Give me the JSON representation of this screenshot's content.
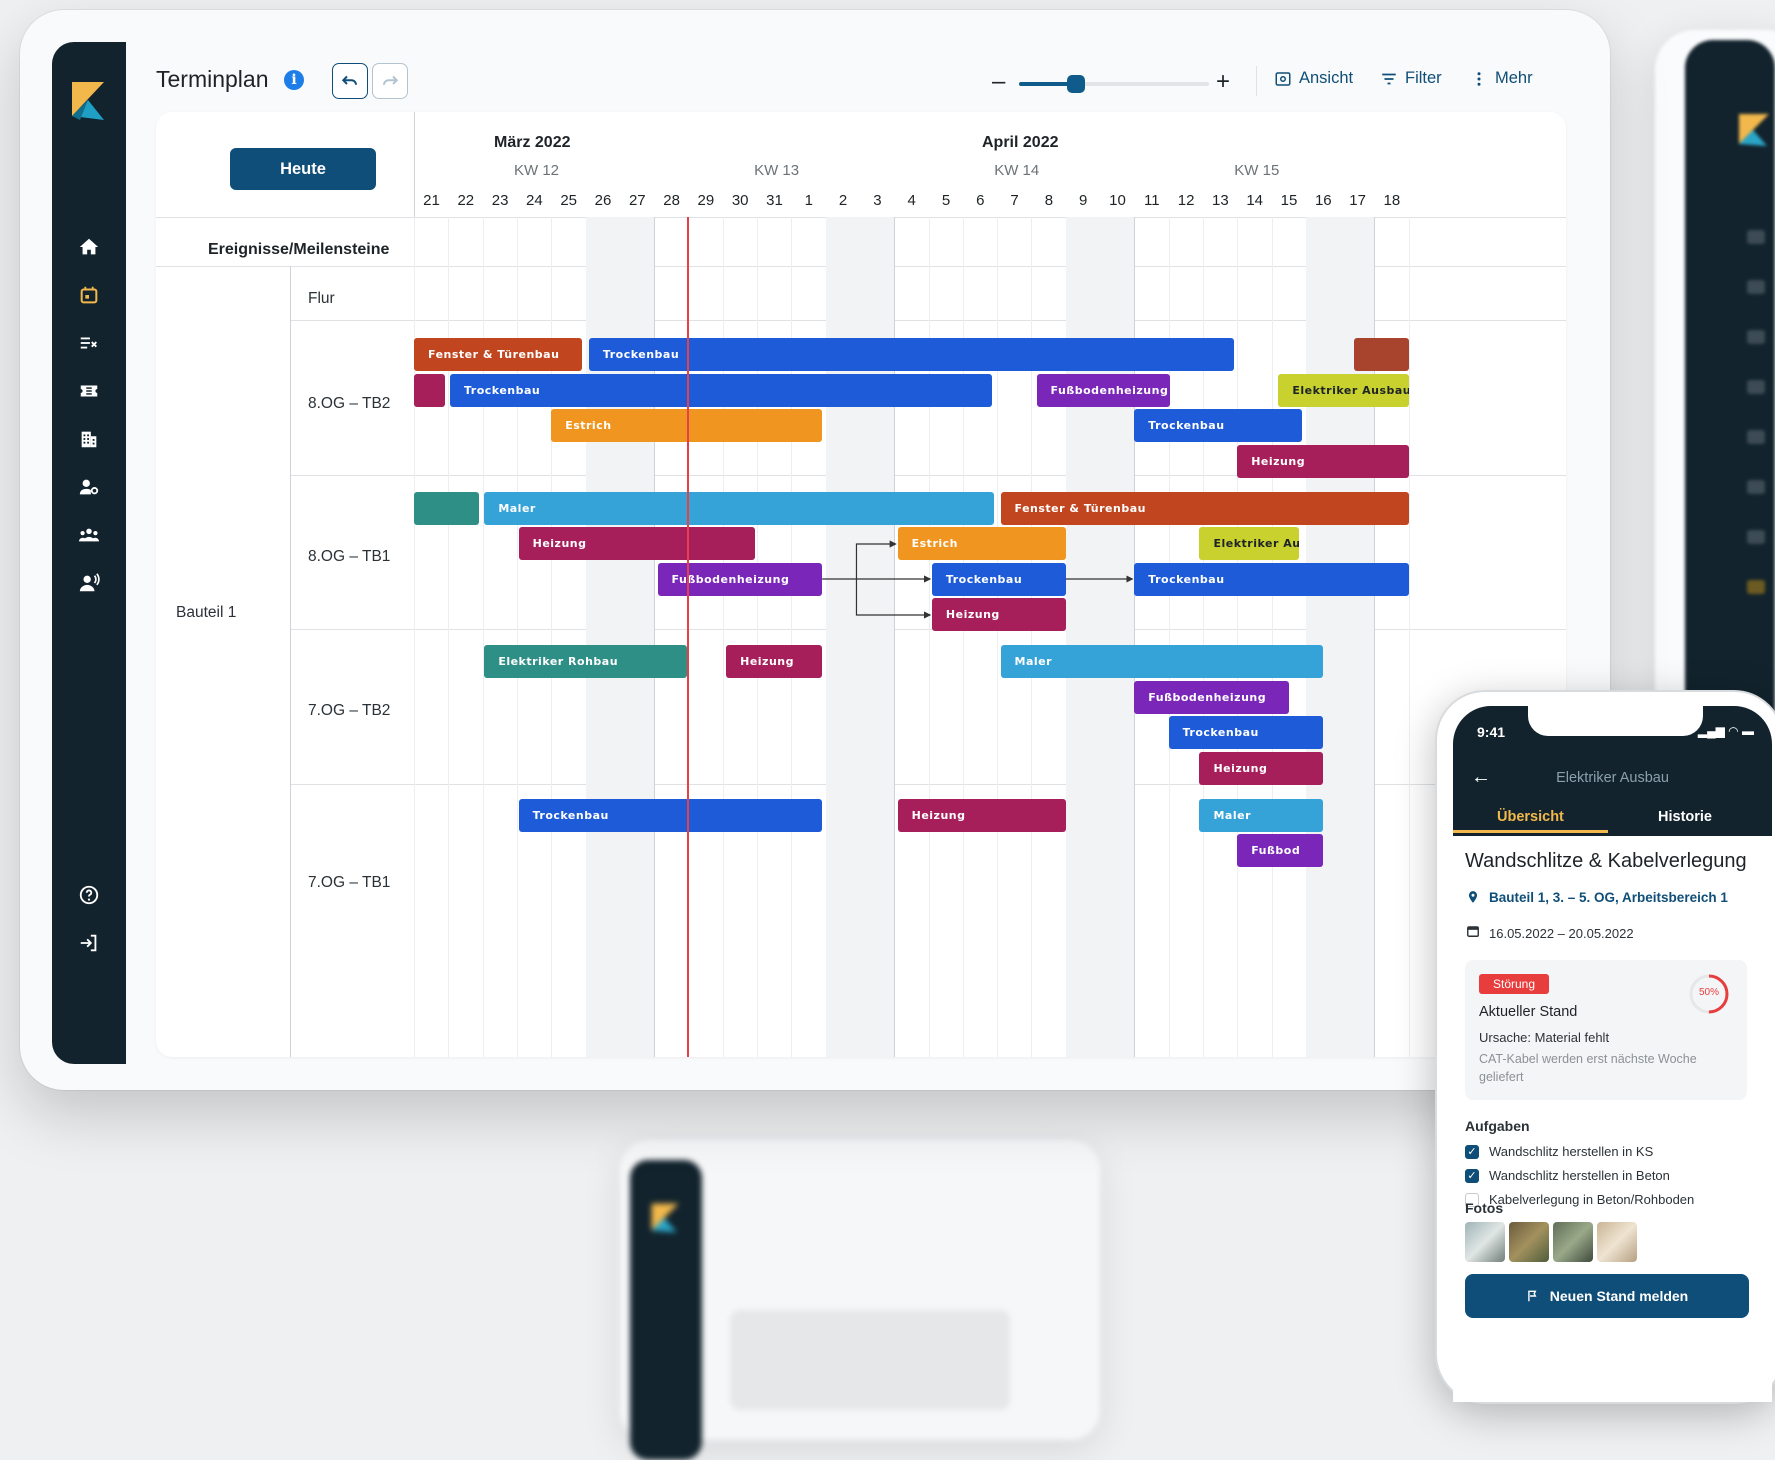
{
  "app": {
    "title": "Terminplan"
  },
  "toolbar": {
    "ansicht": "Ansicht",
    "filter": "Filter",
    "mehr": "Mehr",
    "zoom_level": 0.3
  },
  "gantt": {
    "today_button": "Heute",
    "months": [
      {
        "label": "März 2022"
      },
      {
        "label": "April 2022"
      }
    ],
    "weeks": [
      "KW 12",
      "KW 13",
      "KW 14",
      "KW 15"
    ],
    "days": [
      "21",
      "22",
      "23",
      "24",
      "25",
      "26",
      "27",
      "28",
      "29",
      "30",
      "31",
      "1",
      "2",
      "3",
      "4",
      "5",
      "6",
      "7",
      "8",
      "9",
      "10",
      "11",
      "12",
      "13",
      "14",
      "15",
      "16",
      "17",
      "18"
    ],
    "milestones_label": "Ereignisse/Meilensteine",
    "group_label": "Bauteil 1",
    "rows": [
      "Flur",
      "8.OG – TB2",
      "8.OG – TB1",
      "7.OG – TB2",
      "7.OG – TB1"
    ],
    "bars": [
      {
        "label": "Fenster & Türenbau",
        "color": "#c1461f"
      },
      {
        "label": "Trockenbau",
        "color": "#1d5bd8"
      },
      {
        "label": "",
        "color": "#a8442e"
      },
      {
        "label": "",
        "color": "#a61f5a"
      },
      {
        "label": "Trockenbau",
        "color": "#1d5bd8"
      },
      {
        "label": "Fußbodenheizung",
        "color": "#7a26b8"
      },
      {
        "label": "Elektriker Ausbau",
        "color": "#c9d12e"
      },
      {
        "label": "Estrich",
        "color": "#f0951f"
      },
      {
        "label": "Trockenbau",
        "color": "#1d5bd8"
      },
      {
        "label": "Heizung",
        "color": "#a61f5a"
      },
      {
        "label": "",
        "color": "#2e8f86"
      },
      {
        "label": "Maler",
        "color": "#36a3d8"
      },
      {
        "label": "Fenster & Türenbau",
        "color": "#c1461f"
      },
      {
        "label": "Heizung",
        "color": "#a61f5a"
      },
      {
        "label": "Estrich",
        "color": "#f0951f"
      },
      {
        "label": "Elektriker Aus...",
        "color": "#c9d12e"
      },
      {
        "label": "Fußbodenheizung",
        "color": "#7a26b8"
      },
      {
        "label": "Trockenbau",
        "color": "#1d5bd8"
      },
      {
        "label": "Trockenbau",
        "color": "#1d5bd8"
      },
      {
        "label": "Heizung",
        "color": "#a61f5a"
      },
      {
        "label": "Elektriker Rohbau",
        "color": "#2e8f86"
      },
      {
        "label": "Heizung",
        "color": "#a61f5a"
      },
      {
        "label": "Maler",
        "color": "#36a3d8"
      },
      {
        "label": "Fußbodenheizung",
        "color": "#7a26b8"
      },
      {
        "label": "Trockenbau",
        "color": "#1d5bd8"
      },
      {
        "label": "Heizung",
        "color": "#a61f5a"
      },
      {
        "label": "Trockenbau",
        "color": "#1d5bd8"
      },
      {
        "label": "Heizung",
        "color": "#a61f5a"
      },
      {
        "label": "Maler",
        "color": "#36a3d8"
      },
      {
        "label": "Fußbod",
        "color": "#7a26b8"
      }
    ]
  },
  "phone": {
    "time": "9:41",
    "title": "Elektriker Ausbau",
    "tab_overview": "Übersicht",
    "tab_history": "Historie",
    "heading": "Wandschlitze & Kabelverlegung",
    "location": "Bauteil 1, 3. – 5. OG, Arbeitsbereich 1",
    "dates": "16.05.2022 – 20.05.2022",
    "status_badge": "Störung",
    "progress_label": "50%",
    "progress": 0.5,
    "status_title": "Aktueller Stand",
    "cause": "Ursache: Material fehlt",
    "note": "CAT-Kabel werden erst nächste Woche geliefert",
    "tasks_title": "Aufgaben",
    "tasks": [
      {
        "label": "Wandschlitz herstellen in KS",
        "done": true
      },
      {
        "label": "Wandschlitz herstellen in Beton",
        "done": true
      },
      {
        "label": "Kabelverlegung in Beton/Rohboden",
        "done": false
      }
    ],
    "photos_title": "Fotos",
    "cta": "Neuen Stand melden"
  },
  "colors": {
    "sidebar": "#12232d",
    "primary": "#0f4e78",
    "today": "#e8404a",
    "accent": "#f2b84b",
    "alert": "#e83d3d"
  }
}
